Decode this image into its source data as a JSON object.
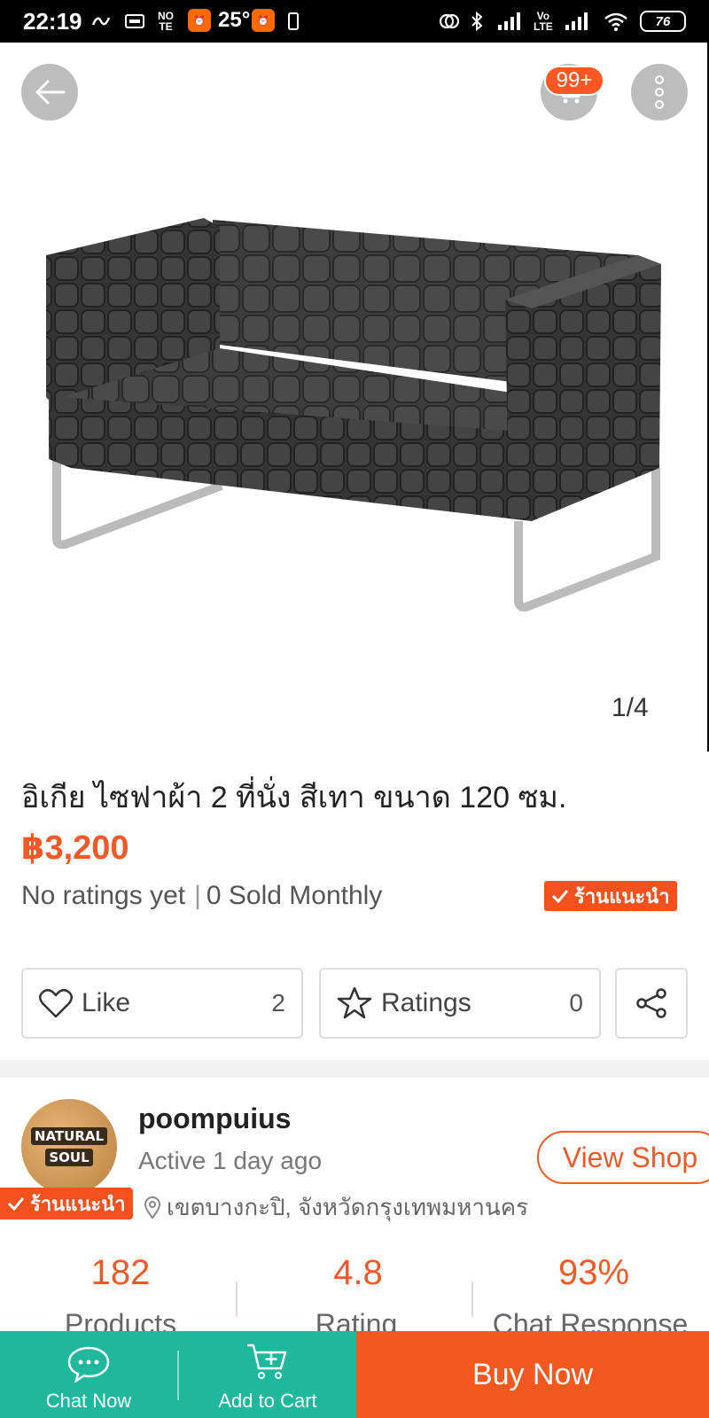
{
  "status_bar": {
    "time": "22:19",
    "temperature": "25°",
    "battery": "76"
  },
  "header": {
    "cart_badge": "99+"
  },
  "gallery": {
    "counter": "1/4"
  },
  "product": {
    "title": "อิเกีย ไซฟาผ้า 2 ที่นั่ง สีเทา ขนาด 120 ซม.",
    "price": "฿3,200",
    "ratings_text": "No ratings yet",
    "sold_text": "0 Sold Monthly",
    "recommended_badge": "ร้านแนะนำ"
  },
  "actions": {
    "like_label": "Like",
    "like_count": "2",
    "ratings_label": "Ratings",
    "ratings_count": "0"
  },
  "shop": {
    "avatar_line1": "NATURAL",
    "avatar_line2": "SOUL",
    "name": "poompuius",
    "active": "Active 1 day ago",
    "view_shop_label": "View Shop",
    "recommended_badge": "ร้านแนะนำ",
    "location": "เขตบางกะปิ, จังหวัดกรุงเทพมหานคร",
    "stats": [
      {
        "value": "182",
        "label": "Products"
      },
      {
        "value": "4.8",
        "label": "Rating"
      },
      {
        "value": "93%",
        "label": "Chat Response"
      }
    ]
  },
  "bottom_bar": {
    "chat_label": "Chat Now",
    "add_cart_label": "Add to Cart",
    "buy_now_label": "Buy Now"
  },
  "colors": {
    "accent": "#f05a28",
    "teal": "#1fb89c"
  }
}
